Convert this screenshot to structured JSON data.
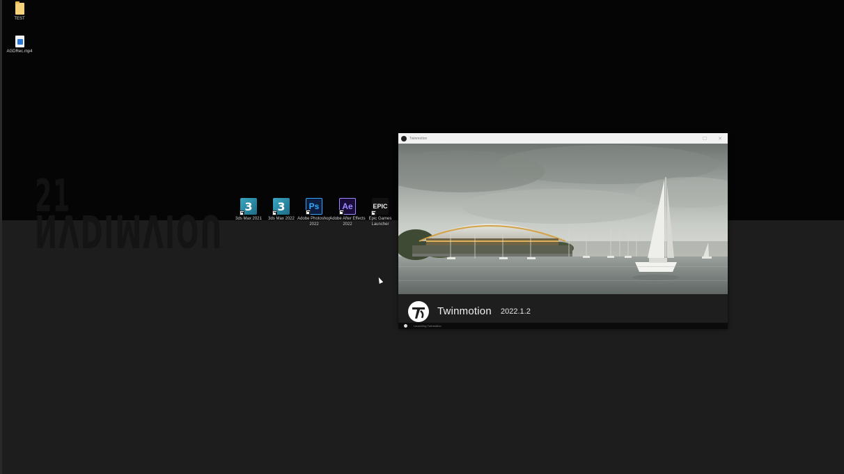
{
  "desktop": {
    "watermark": {
      "number": "21",
      "word": "NVDIMVIOU"
    },
    "top_icons": [
      {
        "name": "test-folder",
        "label": "TEST",
        "kind": "folder"
      },
      {
        "name": "agdrec-video-file",
        "label": "AGDRec.mp4",
        "kind": "video"
      }
    ],
    "app_icons": [
      {
        "name": "3ds-max-2021",
        "label": "3ds Max 2021",
        "glyph": "3",
        "style": "tile-3ds"
      },
      {
        "name": "3ds-max-2022",
        "label": "3ds Max 2022",
        "glyph": "3",
        "style": "tile-3ds"
      },
      {
        "name": "photoshop-2022",
        "label": "Adobe Photoshop 2022",
        "glyph": "Ps",
        "style": "tile-ps"
      },
      {
        "name": "after-effects-2022",
        "label": "Adobe After Effects 2022",
        "glyph": "Ae",
        "style": "tile-ae"
      },
      {
        "name": "epic-games-launcher",
        "label": "Epic Games Launcher",
        "glyph": "EPIC",
        "style": "tile-epic"
      }
    ]
  },
  "splash": {
    "window_title": "Twinmotion",
    "app_name": "Twinmotion",
    "version": "2022.1.2",
    "status_text": "Launching Twinmotion"
  },
  "colors": {
    "desktop_top": "#050505",
    "desktop_bottom": "#1d1d1d",
    "brand_bar": "#1e1e1e"
  }
}
